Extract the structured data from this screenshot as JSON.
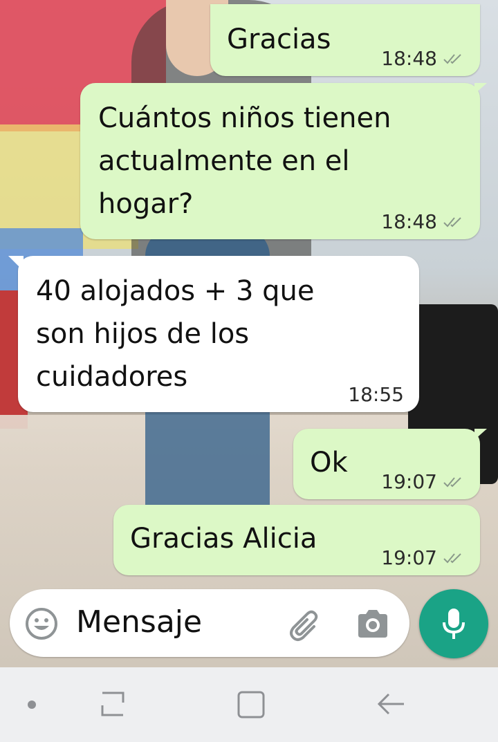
{
  "messages": [
    {
      "direction": "out",
      "text": "Gracias",
      "time": "18:48",
      "status": "read-ticks"
    },
    {
      "direction": "out",
      "text": "Cuántos niños tienen actualmente en el hogar?",
      "time": "18:48",
      "status": "read-ticks"
    },
    {
      "direction": "in",
      "text": "40 alojados + 3 que son hijos de los cuidadores",
      "time": "18:55"
    },
    {
      "direction": "out",
      "text": "Ok",
      "time": "19:07",
      "status": "read-ticks"
    },
    {
      "direction": "out",
      "text": "Gracias Alicia",
      "time": "19:07",
      "status": "read-ticks"
    }
  ],
  "composer": {
    "placeholder": "Mensaje",
    "icons": [
      "emoji-icon",
      "paperclip-icon",
      "camera-icon",
      "mic-icon"
    ]
  },
  "colors": {
    "outgoing_bubble": "#dcf8c6",
    "incoming_bubble": "#ffffff",
    "mic_button": "#1aa386",
    "navbar": "#eeeff1"
  },
  "navbar": {
    "icons": [
      "nav-dot-icon",
      "recent-apps-icon",
      "home-icon",
      "back-icon"
    ]
  }
}
